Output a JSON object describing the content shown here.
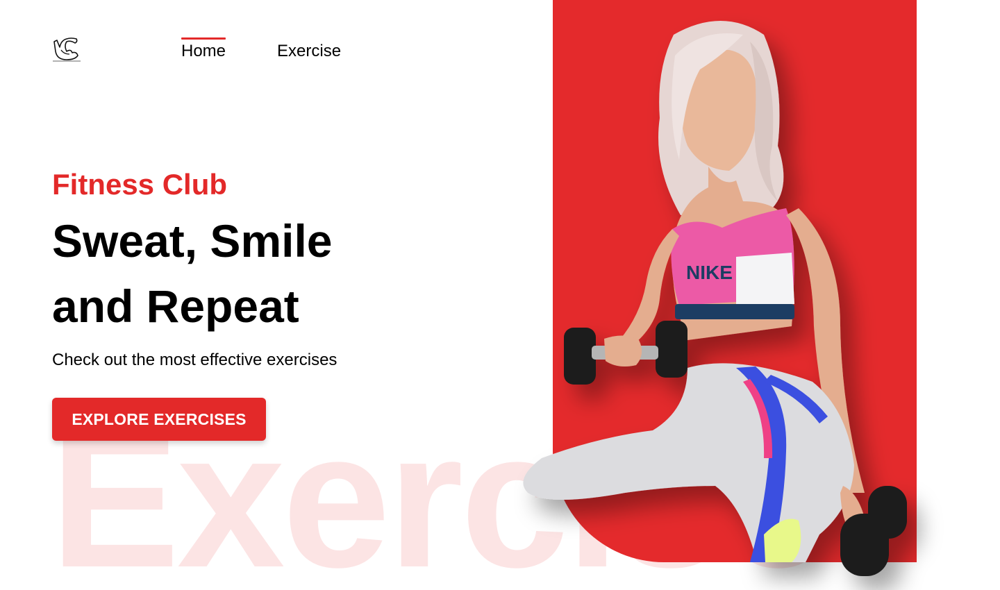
{
  "nav": {
    "items": [
      {
        "label": "Home",
        "active": true
      },
      {
        "label": "Exercise",
        "active": false
      }
    ]
  },
  "hero": {
    "subtitle": "Fitness Club",
    "headline_line1": "Sweat, Smile",
    "headline_line2": "and Repeat",
    "description": "Check out the most effective exercises",
    "cta_label": "EXPLORE EXERCISES",
    "watermark": "Exercise"
  },
  "banner": {
    "top_brand": "NIKE",
    "brand_color": "#e32929",
    "bg_color": "#e42a2c",
    "watermark_color": "#fce4e4"
  },
  "icons": {
    "logo": "flexing-arm-icon"
  }
}
